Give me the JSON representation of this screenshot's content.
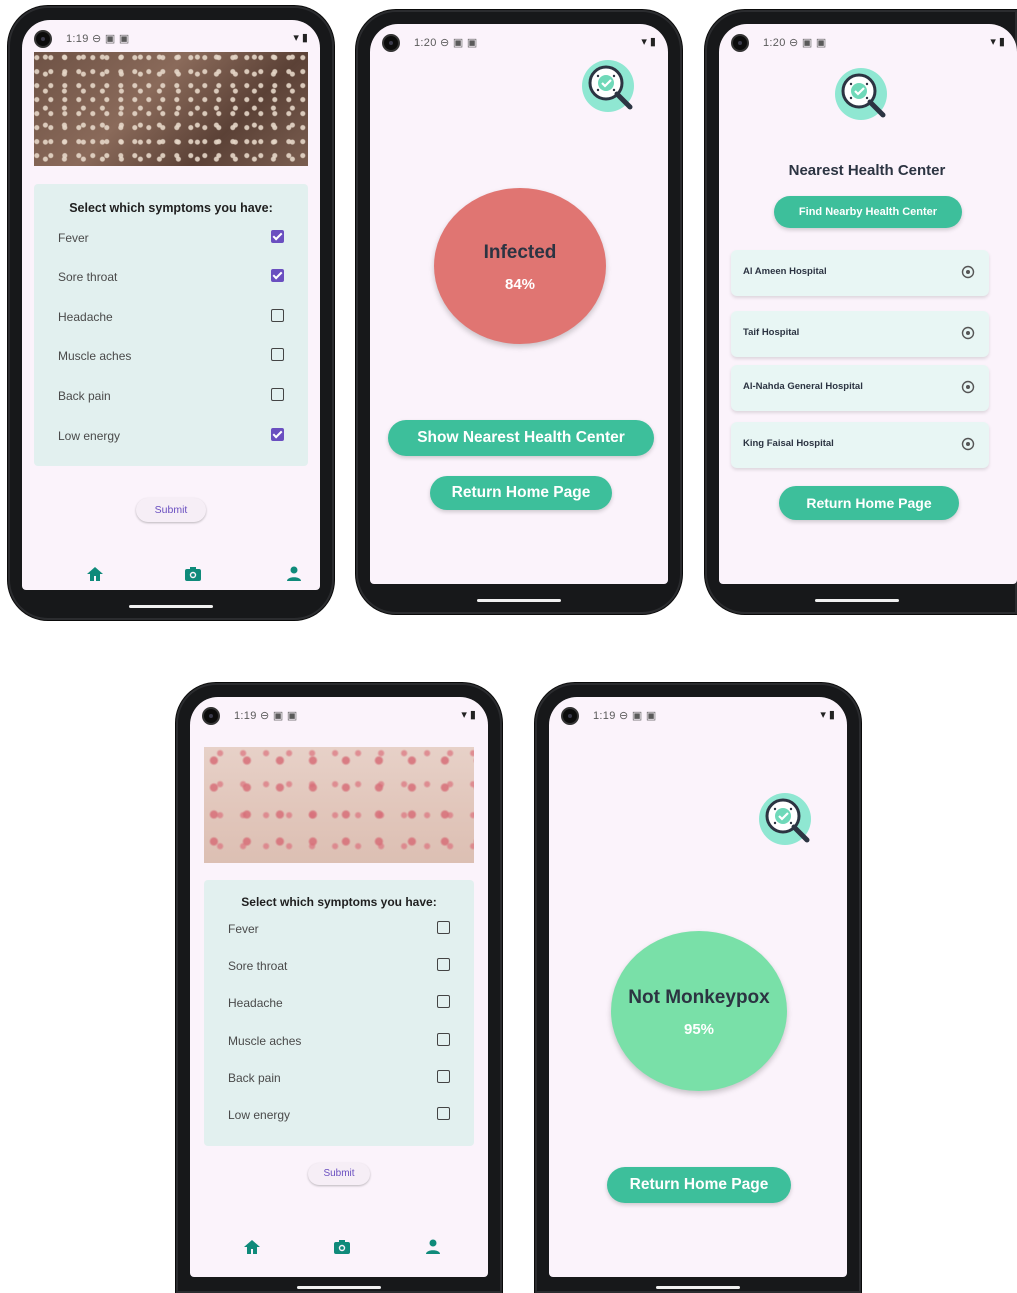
{
  "status": {
    "time_a": "1:19",
    "time_b": "1:20",
    "time_c": "1:20",
    "time_d": "1:19",
    "time_e": "1:19",
    "glyphs": "⊖ ▣ ▣",
    "right_icons": "▾ ▮"
  },
  "symptoms_form": {
    "title": "Select which symptoms you have:",
    "items": [
      "Fever",
      "Sore throat",
      "Headache",
      "Muscle aches",
      "Back pain",
      "Low energy"
    ],
    "checked_first": [
      true,
      true,
      false,
      false,
      false,
      true
    ],
    "checked_second": [
      false,
      false,
      false,
      false,
      false,
      false
    ],
    "submit_label": "Submit"
  },
  "nav": {
    "icons": [
      "home-icon",
      "camera-icon",
      "person-icon"
    ],
    "accent": "#0f8a7a"
  },
  "result_infected": {
    "label": "Infected",
    "percent": "84%",
    "color": "#e07572",
    "label_color": "#2c3442",
    "show_center_button": "Show Nearest Health Center",
    "home_button": "Return Home Page"
  },
  "nearest": {
    "title": "Nearest Health Center",
    "find_button": "Find Nearby Health Center",
    "hospitals": [
      "Al Ameen Hospital",
      "Taif Hospital",
      "Al-Nahda General Hospital",
      "King Faisal Hospital"
    ],
    "home_button": "Return Home Page"
  },
  "result_not": {
    "label": "Not Monkeypox",
    "percent": "95%",
    "color": "#79e0a8",
    "label_color": "#2c3442",
    "home_button": "Return Home Page"
  },
  "colors": {
    "teal": "#3dbf9b",
    "screen_bg": "#fbf3fb",
    "card_bg": "#e2f0ef",
    "checkbox_checked": "#6a4fc0"
  }
}
